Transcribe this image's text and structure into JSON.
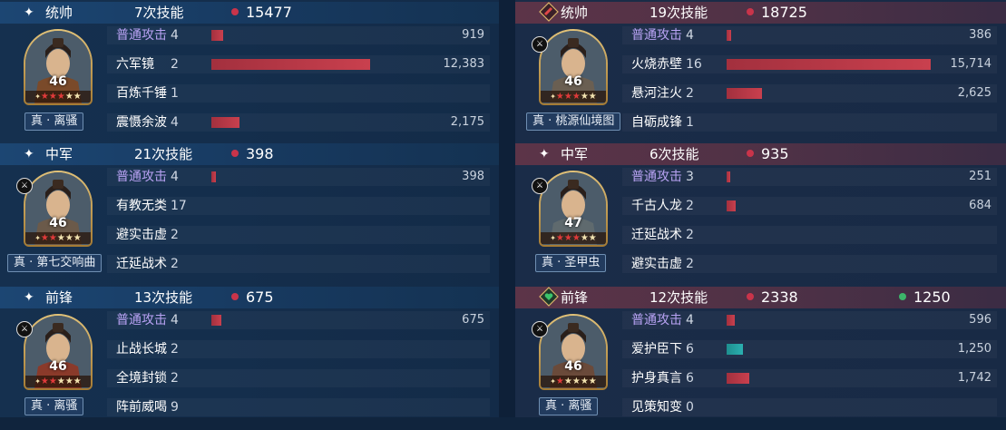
{
  "left": {
    "sections": [
      {
        "rank": "统帅",
        "count": "7次技能",
        "damage": "15477",
        "tag": "真 · 离骚",
        "level": "46",
        "stars_on": 3,
        "skills": [
          {
            "name": "普通攻击",
            "times": "4",
            "value": "919",
            "ratio": 0.07,
            "type": "basic"
          },
          {
            "name": "六军镜",
            "times": "2",
            "value": "12,383",
            "ratio": 0.96,
            "type": "gold"
          },
          {
            "name": "百炼千锤",
            "times": "1",
            "value": "",
            "ratio": 0,
            "type": "gold"
          },
          {
            "name": "震慑余波",
            "times": "4",
            "value": "2,175",
            "ratio": 0.17,
            "type": "gold"
          }
        ]
      },
      {
        "rank": "中军",
        "count": "21次技能",
        "damage": "398",
        "tag": "真 · 第七交响曲",
        "level": "46",
        "stars_on": 2,
        "skills": [
          {
            "name": "普通攻击",
            "times": "4",
            "value": "398",
            "ratio": 0.03,
            "type": "basic"
          },
          {
            "name": "有教无类",
            "times": "17",
            "value": "",
            "ratio": 0,
            "type": "gold"
          },
          {
            "name": "避实击虚",
            "times": "2",
            "value": "",
            "ratio": 0,
            "type": "gold"
          },
          {
            "name": "迁延战术",
            "times": "2",
            "value": "",
            "ratio": 0,
            "type": "gold"
          }
        ]
      },
      {
        "rank": "前锋",
        "count": "13次技能",
        "damage": "675",
        "tag": "真 · 离骚",
        "level": "46",
        "stars_on": 2,
        "skills": [
          {
            "name": "普通攻击",
            "times": "4",
            "value": "675",
            "ratio": 0.06,
            "type": "basic"
          },
          {
            "name": "止战长城",
            "times": "2",
            "value": "",
            "ratio": 0,
            "type": "gold"
          },
          {
            "name": "全境封锁",
            "times": "2",
            "value": "",
            "ratio": 0,
            "type": "gold"
          },
          {
            "name": "阵前威喝",
            "times": "9",
            "value": "",
            "ratio": 0,
            "type": "gold"
          }
        ]
      }
    ]
  },
  "right": {
    "sections": [
      {
        "rank": "统帅",
        "count": "19次技能",
        "damage": "18725",
        "heal": "",
        "tag": "真 · 桃源仙境图",
        "level": "46",
        "stars_on": 3,
        "skills": [
          {
            "name": "普通攻击",
            "times": "4",
            "value": "386",
            "ratio": 0.02,
            "type": "basic"
          },
          {
            "name": "火烧赤壁",
            "times": "16",
            "value": "15,714",
            "ratio": 0.98,
            "type": "gold"
          },
          {
            "name": "悬河注火",
            "times": "2",
            "value": "2,625",
            "ratio": 0.17,
            "type": "gold"
          },
          {
            "name": "自砺成锋",
            "times": "1",
            "value": "",
            "ratio": 0,
            "type": "gold"
          }
        ]
      },
      {
        "rank": "中军",
        "count": "6次技能",
        "damage": "935",
        "heal": "",
        "tag": "真 · 圣甲虫",
        "level": "47",
        "stars_on": 3,
        "skills": [
          {
            "name": "普通攻击",
            "times": "3",
            "value": "251",
            "ratio": 0.015,
            "type": "basic"
          },
          {
            "name": "千古人龙",
            "times": "2",
            "value": "684",
            "ratio": 0.045,
            "type": "gold"
          },
          {
            "name": "迁延战术",
            "times": "2",
            "value": "",
            "ratio": 0,
            "type": "gold"
          },
          {
            "name": "避实击虚",
            "times": "2",
            "value": "",
            "ratio": 0,
            "type": "gold"
          }
        ]
      },
      {
        "rank": "前锋",
        "count": "12次技能",
        "damage": "2338",
        "heal": "1250",
        "tag": "真 · 离骚",
        "level": "46",
        "stars_on": 1,
        "skills": [
          {
            "name": "普通攻击",
            "times": "4",
            "value": "596",
            "ratio": 0.04,
            "type": "basic"
          },
          {
            "name": "爱护臣下",
            "times": "6",
            "value": "1,250",
            "ratio": 0.08,
            "type": "heal"
          },
          {
            "name": "护身真言",
            "times": "6",
            "value": "1,742",
            "ratio": 0.11,
            "type": "gold"
          },
          {
            "name": "见策知变",
            "times": "0",
            "value": "",
            "ratio": 0,
            "type": "gold"
          }
        ]
      }
    ]
  },
  "colors": {
    "damage_dot": "#c9344a",
    "heal_dot": "#3cb56a",
    "bar_damage": "#c9404e",
    "bar_heal": "#2bb0b0"
  }
}
